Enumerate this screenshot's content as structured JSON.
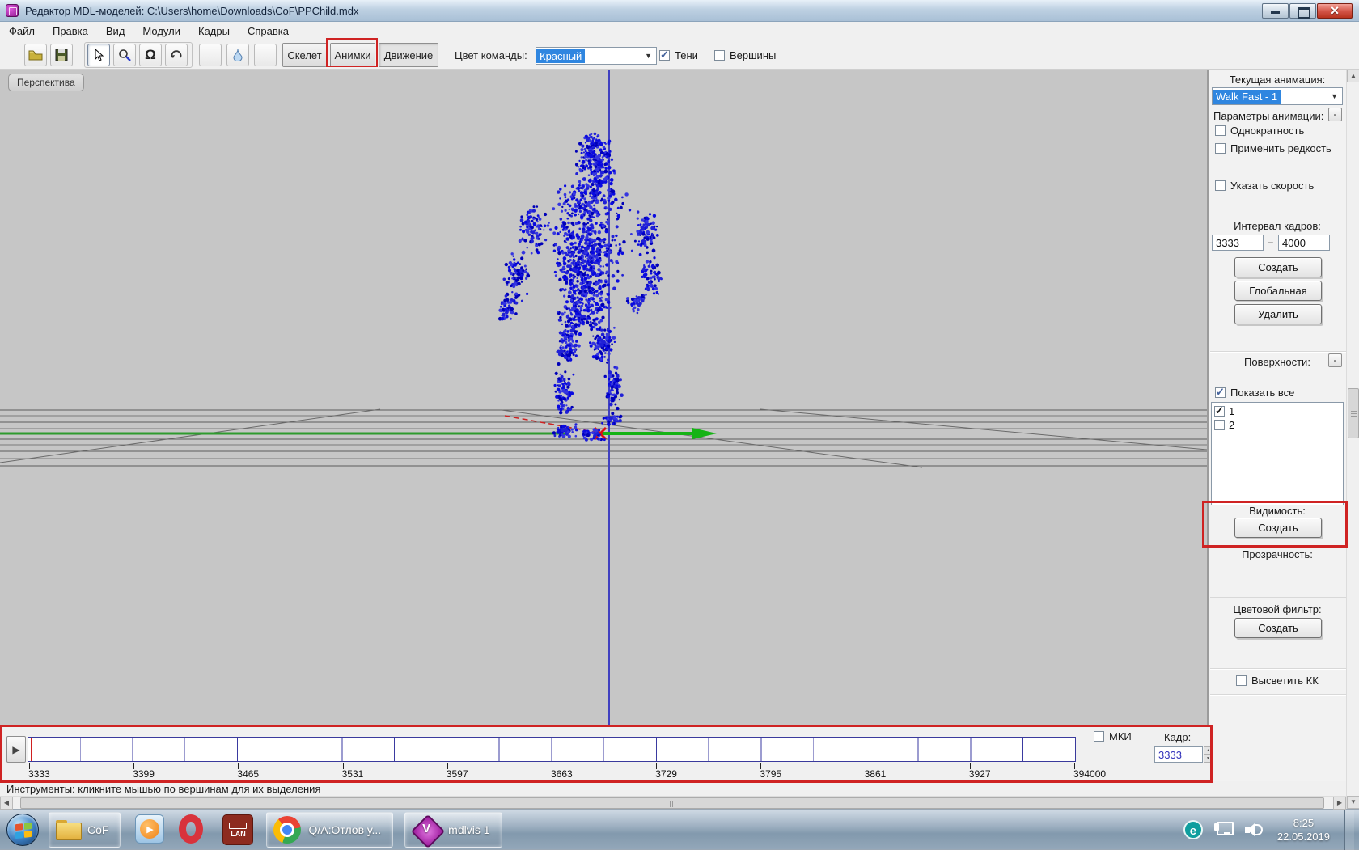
{
  "window": {
    "title": "Редактор MDL-моделей: C:\\Users\\home\\Downloads\\CoF\\PPChild.mdx"
  },
  "menu": {
    "items": [
      "Файл",
      "Правка",
      "Вид",
      "Модули",
      "Кадры",
      "Справка"
    ]
  },
  "toolbar": {
    "skeleton": "Скелет",
    "anims": "Анимки",
    "movement": "Движение",
    "team_color_label": "Цвет команды:",
    "team_color_value": "Красный",
    "shadows": "Тени",
    "vertices": "Вершины"
  },
  "viewport": {
    "view_label": "Перспектива"
  },
  "sidebar": {
    "current_animation_label": "Текущая анимация:",
    "current_animation_value": "Walk Fast - 1",
    "params_label": "Параметры анимации:",
    "collapse": "-",
    "cb_once": "Однократность",
    "cb_rarity": "Применить редкость",
    "cb_speed": "Указать скорость",
    "interval_label": "Интервал кадров:",
    "interval_from": "3333",
    "interval_dash": "–",
    "interval_to": "4000",
    "btn_create": "Создать",
    "btn_global": "Глобальная",
    "btn_delete": "Удалить",
    "surfaces_label": "Поверхности:",
    "cb_show_all": "Показать все",
    "surfaces": [
      {
        "label": "1",
        "checked": true
      },
      {
        "label": "2",
        "checked": false
      }
    ],
    "visibility_label": "Видимость:",
    "btn_visibility_create": "Создать",
    "transparency_label": "Прозрачность:",
    "color_filter_label": "Цветовой фильтр:",
    "btn_color_filter_create": "Создать",
    "cb_highlight": "Высветить КК"
  },
  "timeline": {
    "labels": [
      "3333",
      "3399",
      "3465",
      "3531",
      "3597",
      "3663",
      "3729",
      "3795",
      "3861",
      "3927",
      "394000"
    ],
    "mki": "МКИ",
    "frame_label": "Кадр:",
    "frame_value": "3333"
  },
  "statusbar": {
    "text": "Инструменты: кликните мышью по вершинам для их выделения"
  },
  "taskbar": {
    "folder_app": "CoF",
    "chrome_app": "Q/A:Отлов у...",
    "mdlvis_app": "mdlvis 1",
    "lan_label": "LAN",
    "eset_label": "e",
    "clock_time": "8:25",
    "clock_date": "22.05.2019"
  },
  "colors": {
    "annotation_red": "#cf2323",
    "selection_blue": "#2f86e0",
    "model_points": "#0a0ae0",
    "axis_green": "#18a818",
    "axis_blue": "#4040c0",
    "axis_red": "#cc1111"
  }
}
